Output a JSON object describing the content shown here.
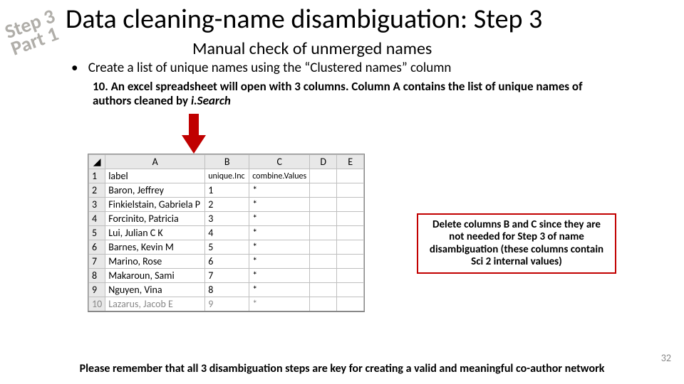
{
  "stamp": {
    "line1": "Step 3",
    "line2": "Part 1"
  },
  "title": "Data cleaning-name disambiguation: Step 3",
  "subtitle": "Manual check of unmerged names",
  "bullet": "Create a list of unique names using the “Clustered names” column",
  "step_prefix": "10. An excel spreadsheet will open with 3 columns. Column A contains the list of unique names of authors cleaned by ",
  "step_em": "i.Search",
  "table": {
    "cols": [
      "A",
      "B",
      "C",
      "D",
      "E"
    ],
    "header_row": {
      "A": "label",
      "B": "unique.Inc",
      "C": "combine.Values",
      "D": "",
      "E": ""
    },
    "rows": [
      {
        "n": "2",
        "A": "Baron, Jeffrey",
        "B": "1",
        "C": "*"
      },
      {
        "n": "3",
        "A": "Finkielstain, Gabriela P",
        "B": "2",
        "C": "*"
      },
      {
        "n": "4",
        "A": "Forcinito, Patricia",
        "B": "3",
        "C": "*"
      },
      {
        "n": "5",
        "A": "Lui, Julian C K",
        "B": "4",
        "C": "*"
      },
      {
        "n": "6",
        "A": "Barnes, Kevin M",
        "B": "5",
        "C": "*"
      },
      {
        "n": "7",
        "A": "Marino, Rose",
        "B": "6",
        "C": "*"
      },
      {
        "n": "8",
        "A": "Makaroun, Sami",
        "B": "7",
        "C": "*"
      },
      {
        "n": "9",
        "A": "Nguyen, Vina",
        "B": "8",
        "C": "*"
      },
      {
        "n": "10",
        "A": "Lazarus, Jacob E",
        "B": "9",
        "C": "*"
      }
    ]
  },
  "callout": "Delete columns B and C since they are not needed for Step 3 of name disambiguation (these columns contain Sci 2 internal values)",
  "footer": "Please remember that all 3 disambiguation steps are key for creating a valid and meaningful co-author network",
  "pagenum": "32"
}
